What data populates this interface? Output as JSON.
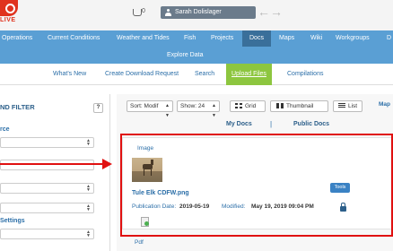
{
  "topbar": {
    "logo_text": "LIVE",
    "cart_count": "0",
    "user_name": "Sarah Dolislager",
    "back_arrow": "←",
    "forward_arrow": "→"
  },
  "main_nav": {
    "items": [
      "Operations",
      "Current Conditions",
      "Weather and Tides",
      "Fish",
      "Projects",
      "Docs",
      "Maps",
      "Wiki",
      "Workgroups",
      "D"
    ],
    "active": "Docs"
  },
  "sub_nav": {
    "item": "Explore Data"
  },
  "tabs": {
    "items": [
      "What's New",
      "Create Download Request",
      "Search",
      "Upload Files",
      "Compilations"
    ],
    "active": "Upload Files"
  },
  "filter_panel": {
    "title": "ND FILTER",
    "help": "?",
    "labels": [
      "rce",
      "Settings"
    ]
  },
  "controls": {
    "sort": "Sort: Modif",
    "show": "Show: 24",
    "grid": "Grid",
    "thumbnail": "Thumbnail",
    "list": "List",
    "map": "Map"
  },
  "doc_tabs": {
    "my_docs": "My Docs",
    "separator": "|",
    "public_docs": "Public Docs"
  },
  "document": {
    "type": "Image",
    "name": "Tule Elk CDFW.png",
    "publication_label": "Publication Date:",
    "publication_date": "2019-05-19",
    "modified_label": "Modified:",
    "modified_date": "May 19, 2019 09:04 PM",
    "tools_label": "Tools"
  },
  "next_document": {
    "type": "Pdf"
  },
  "colors": {
    "nav_blue": "#5a9fd4",
    "active_nav": "#3a6f9a",
    "active_tab_green": "#8dc63f",
    "annotation_red": "#e01010",
    "logo_red": "#e0331e"
  },
  "icons": [
    "cart-icon",
    "user-icon",
    "back-arrow-icon",
    "forward-arrow-icon",
    "grid-icon",
    "thumbnail-icon",
    "list-icon",
    "lock-icon",
    "file-icon",
    "sort-caret-icon"
  ]
}
